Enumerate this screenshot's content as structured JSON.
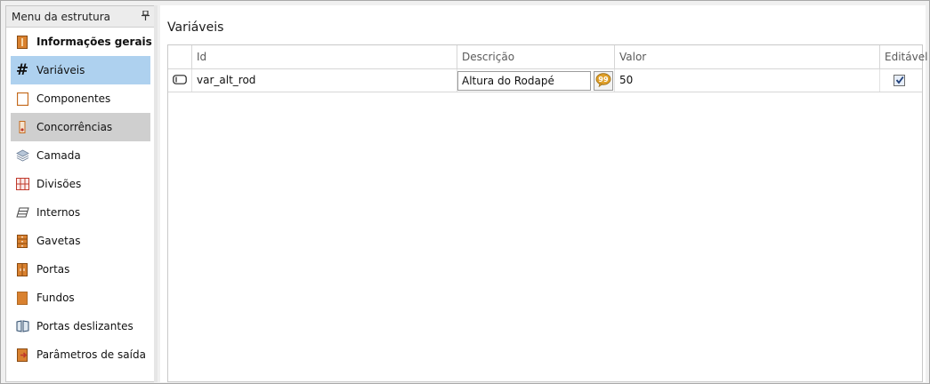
{
  "sidebar": {
    "title": "Menu da estrutura",
    "pin_icon": "pin-icon",
    "items": [
      {
        "label": "Informações gerais",
        "icon": "general-info-icon",
        "state": "bold"
      },
      {
        "label": "Variáveis",
        "icon": "hash-icon",
        "state": "selected"
      },
      {
        "label": "Componentes",
        "icon": "component-icon",
        "state": ""
      },
      {
        "label": "Concorrências",
        "icon": "concurrency-icon",
        "state": "hovered"
      },
      {
        "label": "Camada",
        "icon": "layer-icon",
        "state": ""
      },
      {
        "label": "Divisões",
        "icon": "divisions-icon",
        "state": ""
      },
      {
        "label": "Internos",
        "icon": "internals-icon",
        "state": ""
      },
      {
        "label": "Gavetas",
        "icon": "drawers-icon",
        "state": ""
      },
      {
        "label": "Portas",
        "icon": "doors-icon",
        "state": ""
      },
      {
        "label": "Fundos",
        "icon": "backs-icon",
        "state": ""
      },
      {
        "label": "Portas deslizantes",
        "icon": "sliding-doors-icon",
        "state": ""
      },
      {
        "label": "Parâmetros de saída",
        "icon": "output-params-icon",
        "state": ""
      }
    ]
  },
  "main": {
    "title": "Variáveis",
    "columns": {
      "id": "Id",
      "description": "Descrição",
      "value": "Valor",
      "editable": "Editável"
    },
    "rows": [
      {
        "id": "var_alt_rod",
        "description": "Altura do Rodapé",
        "value": "50",
        "editable": true
      }
    ]
  },
  "colors": {
    "selected": "#aed1ef",
    "hovered": "#cfcfcf",
    "accent_orange": "#d9812f"
  }
}
